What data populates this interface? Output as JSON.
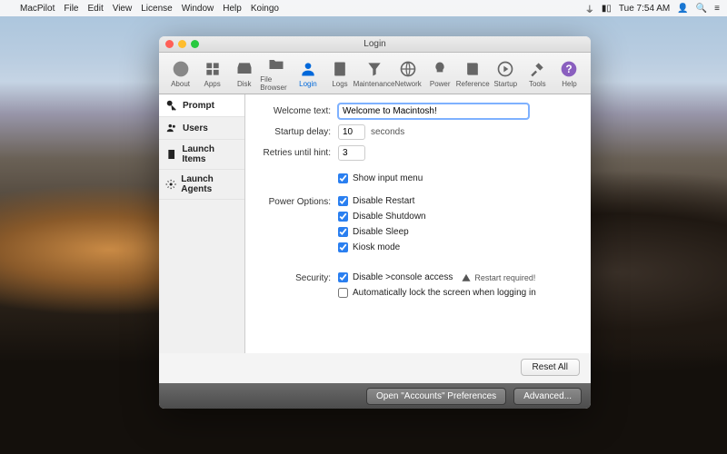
{
  "menubar": {
    "app": "MacPilot",
    "items": [
      "File",
      "Edit",
      "View",
      "License",
      "Window",
      "Help",
      "Koingo"
    ],
    "status_time": "Tue 7:54 AM"
  },
  "window": {
    "title": "Login"
  },
  "toolbar": {
    "about": "About",
    "apps": "Apps",
    "disk": "Disk",
    "filebrowser": "File Browser",
    "login": "Login",
    "logs": "Logs",
    "maintenance": "Maintenance",
    "network": "Network",
    "power": "Power",
    "reference": "Reference",
    "startup": "Startup",
    "tools": "Tools",
    "help": "Help"
  },
  "sidebar": {
    "prompt": "Prompt",
    "users": "Users",
    "launch_items": "Launch Items",
    "launch_agents": "Launch Agents"
  },
  "form": {
    "welcome_label": "Welcome text:",
    "welcome_value": "Welcome to Macintosh!",
    "startup_label": "Startup delay:",
    "startup_value": "10",
    "startup_unit": "seconds",
    "retries_label": "Retries until hint:",
    "retries_value": "3",
    "show_input_menu": "Show input menu",
    "power_label": "Power Options:",
    "power_opts": [
      "Disable Restart",
      "Disable Shutdown",
      "Disable Sleep",
      "Kiosk mode"
    ],
    "security_label": "Security:",
    "sec_console": "Disable >console access",
    "restart_required": "Restart required!",
    "sec_autolock": "Automatically lock the screen when logging in"
  },
  "buttons": {
    "reset": "Reset All",
    "open_accounts": "Open \"Accounts\" Preferences",
    "advanced": "Advanced..."
  }
}
